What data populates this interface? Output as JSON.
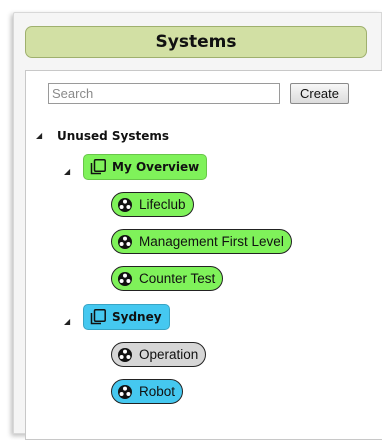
{
  "header": {
    "title": "Systems"
  },
  "search": {
    "placeholder": "Search",
    "value": ""
  },
  "toolbar": {
    "create_label": "Create"
  },
  "colors": {
    "header_bg": "#d2e0a4",
    "green_node": "#7ff25a",
    "blue_node": "#45c8f0",
    "gray_node": "#d6d6d6"
  },
  "tree": {
    "root": {
      "label": "Unused Systems",
      "expanded": true
    },
    "groups": [
      {
        "label": "My Overview",
        "color": "#7ff25a",
        "icon": "copy-icon",
        "expanded": true,
        "items": [
          {
            "label": "Lifeclub",
            "color": "#7ff25a",
            "icon": "system-icon"
          },
          {
            "label": "Management First Level",
            "color": "#7ff25a",
            "icon": "system-icon"
          },
          {
            "label": "Counter Test",
            "color": "#7ff25a",
            "icon": "system-icon"
          }
        ]
      },
      {
        "label": "Sydney",
        "color": "#45c8f0",
        "icon": "copy-icon",
        "expanded": true,
        "items": [
          {
            "label": "Operation",
            "color": "#d6d6d6",
            "icon": "system-icon"
          },
          {
            "label": "Robot",
            "color": "#45c8f0",
            "icon": "system-icon"
          }
        ]
      }
    ]
  }
}
